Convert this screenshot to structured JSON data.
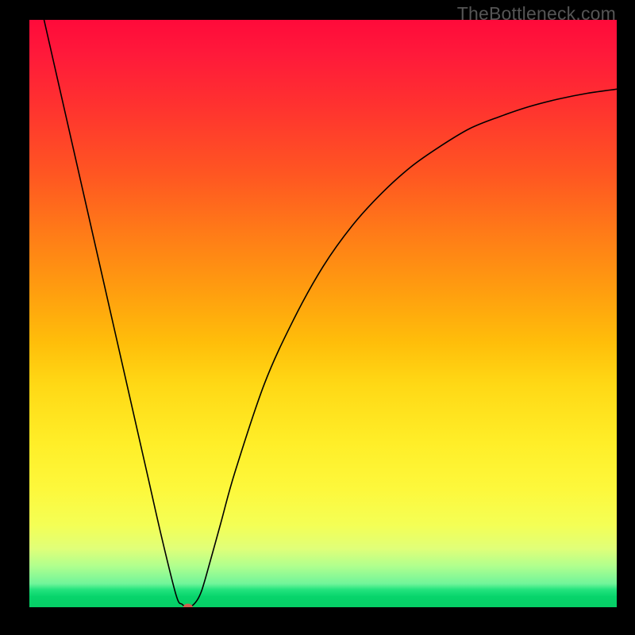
{
  "watermark": "TheBottleneck.com",
  "chart_data": {
    "type": "line",
    "title": "",
    "xlabel": "",
    "ylabel": "",
    "xlim": [
      0,
      1
    ],
    "ylim": [
      0,
      1
    ],
    "background_gradient": {
      "top_color": "#ff0a3a",
      "bottom_color": "#06cf66",
      "meaning": "red = worse, green = better"
    },
    "series": [
      {
        "name": "bottleneck-curve",
        "color": "#000000",
        "x": [
          0.025,
          0.05,
          0.075,
          0.1,
          0.125,
          0.15,
          0.175,
          0.2,
          0.225,
          0.25,
          0.26,
          0.27,
          0.28,
          0.29,
          0.3,
          0.325,
          0.35,
          0.4,
          0.45,
          0.5,
          0.55,
          0.6,
          0.65,
          0.7,
          0.75,
          0.8,
          0.85,
          0.9,
          0.95,
          1.0
        ],
        "y": [
          1.0,
          0.89,
          0.78,
          0.67,
          0.56,
          0.45,
          0.34,
          0.23,
          0.12,
          0.02,
          0.005,
          0.0,
          0.005,
          0.02,
          0.05,
          0.14,
          0.23,
          0.38,
          0.49,
          0.58,
          0.65,
          0.705,
          0.75,
          0.785,
          0.815,
          0.835,
          0.852,
          0.865,
          0.875,
          0.882
        ]
      }
    ],
    "marker": {
      "name": "current-point",
      "x": 0.27,
      "y": 0.0,
      "color": "#d06050",
      "rx": 6,
      "ry": 4.5
    }
  }
}
